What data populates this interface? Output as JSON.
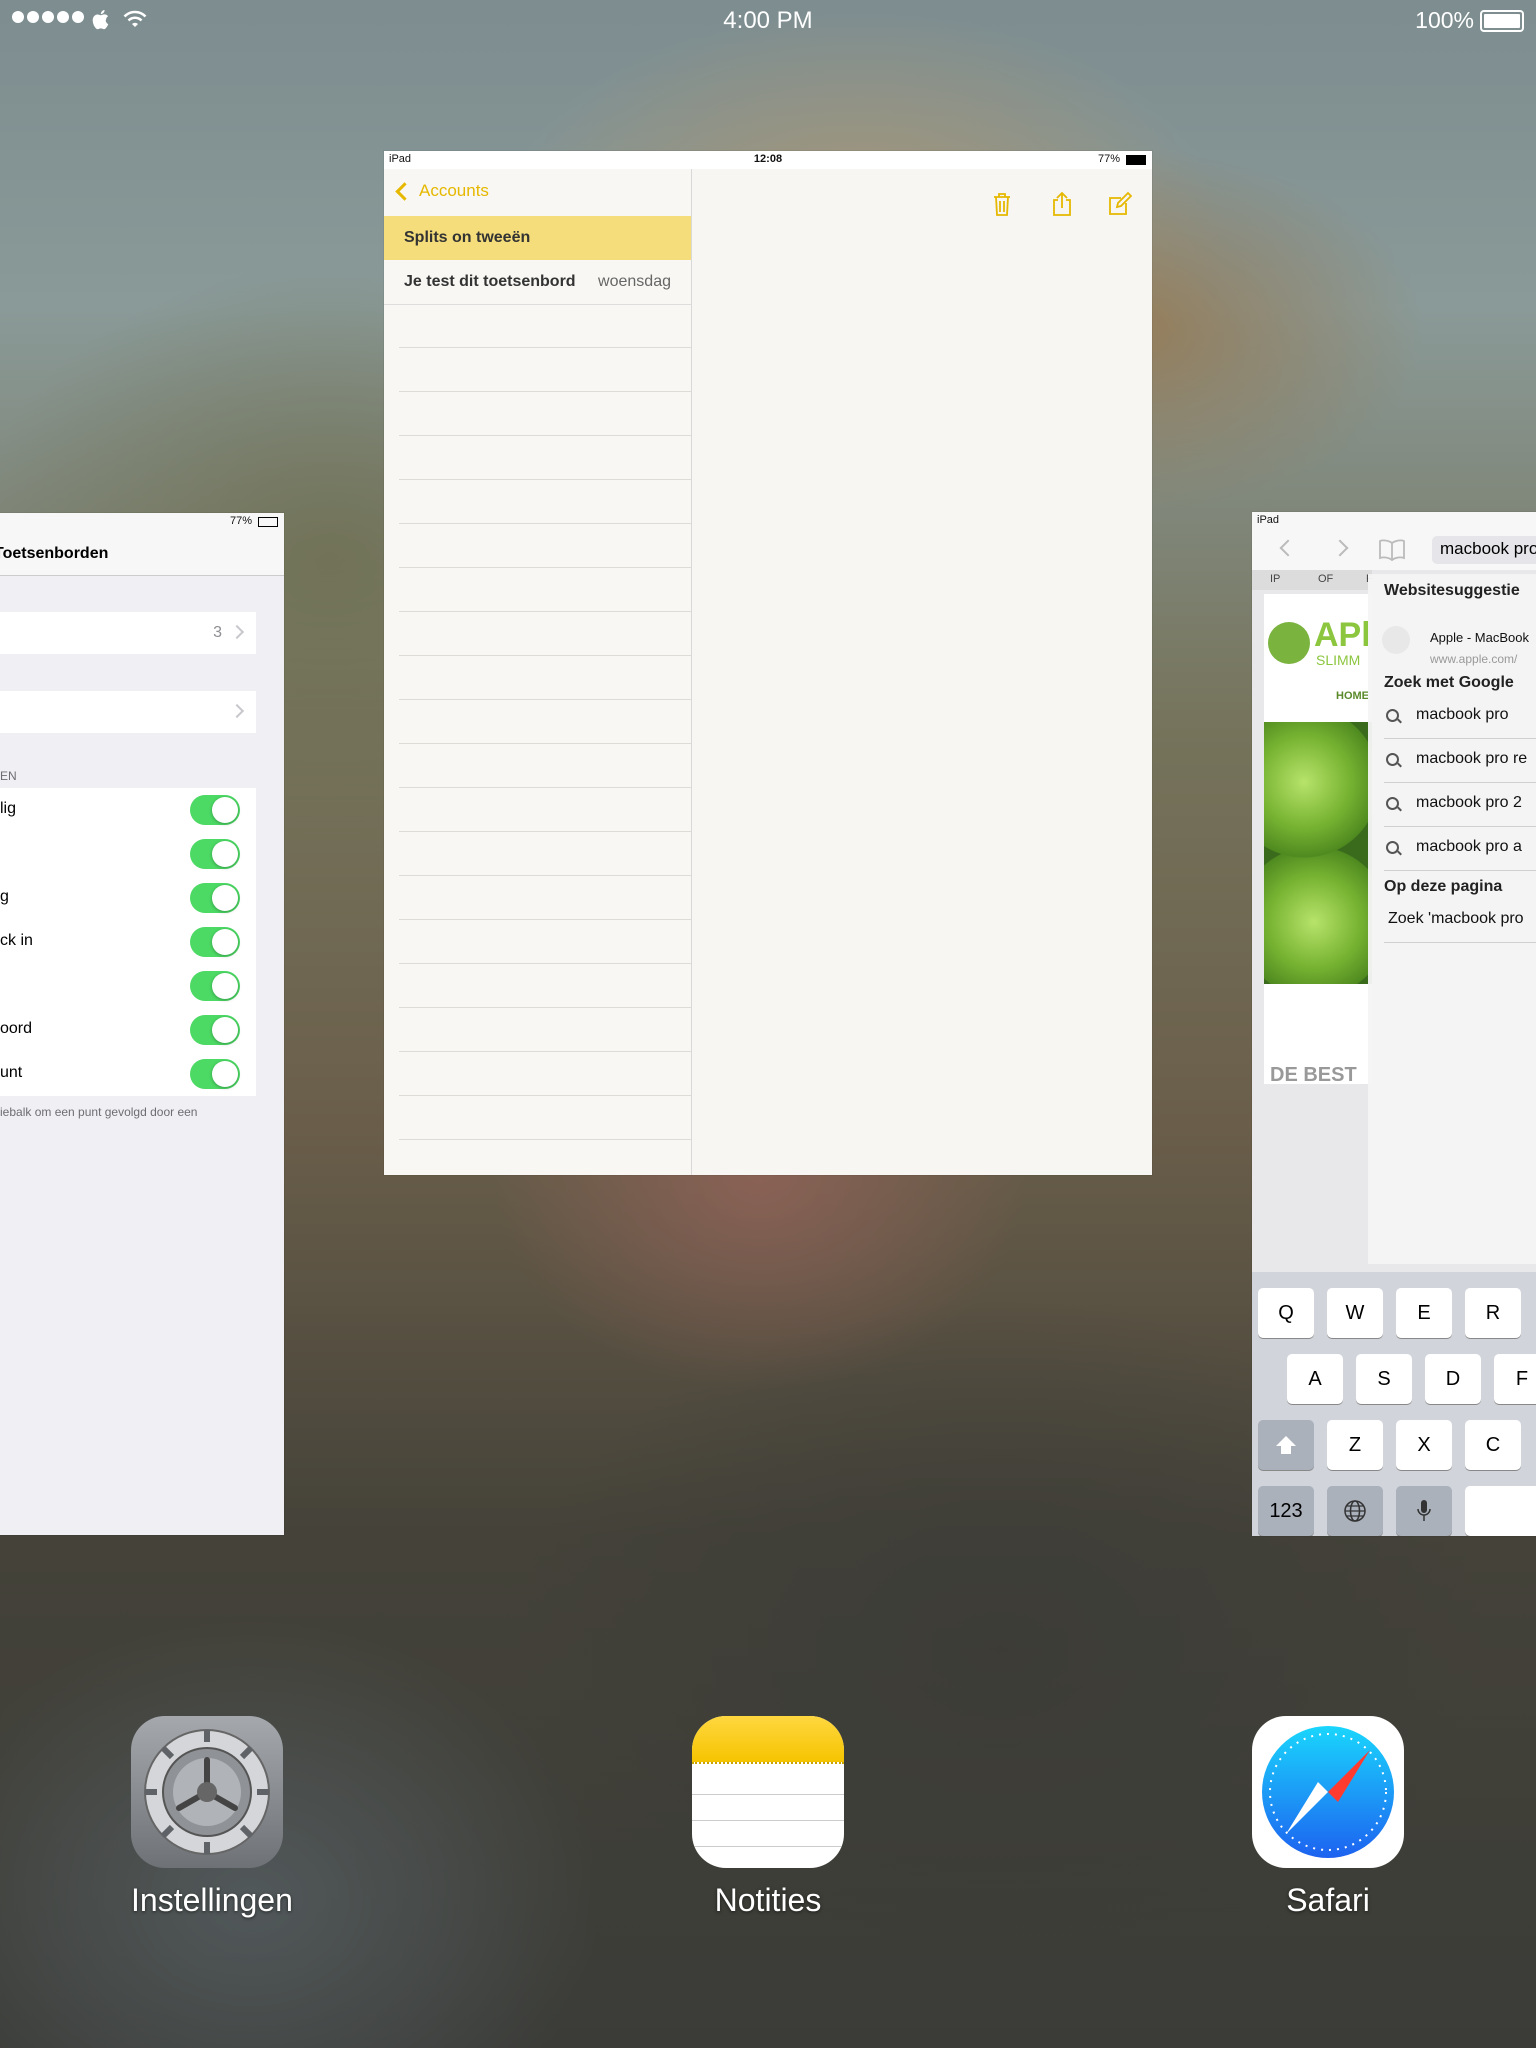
{
  "statusbar": {
    "time": "4:00 PM",
    "battery": "100%"
  },
  "settings_card": {
    "mini_battery": "77%",
    "nav_title": "Toetsenborden",
    "row1_value": "3",
    "section_header": "EN",
    "toggles": [
      {
        "label": "lig"
      },
      {
        "label": ""
      },
      {
        "label": "g"
      },
      {
        "label": "ck in"
      },
      {
        "label": ""
      },
      {
        "label": "oord"
      },
      {
        "label": "unt"
      }
    ],
    "footnote": "iebalk om een punt gevolgd door een"
  },
  "notes_card": {
    "device": "iPad",
    "time": "12:08",
    "battery": "77%",
    "back_label": "Accounts",
    "selected_note": "Splits on tweeën",
    "notes": [
      {
        "title": "Je test dit toetsenbord",
        "date": "woensdag"
      }
    ]
  },
  "safari_card": {
    "device": "iPad",
    "address": "macbook pro",
    "tabs": [
      "IP",
      "OF",
      "F"
    ],
    "web": {
      "title": "APl",
      "subtitle": "SLIMM",
      "home": "HOME",
      "bottom": "DE BEST"
    },
    "suggestions": {
      "header_site": "Websitesuggestie",
      "site_title": "Apple - MacBook",
      "site_url": "www.apple.com/",
      "header_google": "Zoek met Google",
      "google": [
        "macbook pro",
        "macbook pro re",
        "macbook pro 2",
        "macbook pro a"
      ],
      "header_page": "Op deze pagina",
      "page_find": "Zoek 'macbook pro"
    },
    "keyboard": {
      "row1": [
        "Q",
        "W",
        "E",
        "R"
      ],
      "row2": [
        "A",
        "S",
        "D",
        "F"
      ],
      "row3": [
        "Z",
        "X",
        "C"
      ],
      "numbers": "123"
    }
  },
  "dock": {
    "apps": [
      {
        "name": "Instellingen",
        "icon": "settings-gear-icon"
      },
      {
        "name": "Notities",
        "icon": "notes-icon"
      },
      {
        "name": "Safari",
        "icon": "safari-compass-icon"
      }
    ]
  }
}
